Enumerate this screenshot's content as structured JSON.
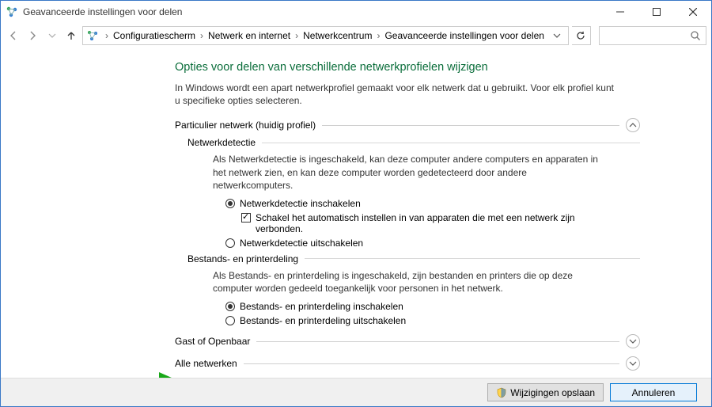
{
  "window": {
    "title": "Geavanceerde instellingen voor delen"
  },
  "breadcrumb": {
    "seg1": "Configuratiescherm",
    "seg2": "Netwerk en internet",
    "seg3": "Netwerkcentrum",
    "seg4": "Geavanceerde instellingen voor delen"
  },
  "page": {
    "heading": "Opties voor delen van verschillende netwerkprofielen wijzigen",
    "sub": "In Windows wordt een apart netwerkprofiel gemaakt voor elk netwerk dat u gebruikt. Voor elk profiel kunt u specifieke opties selecteren."
  },
  "sections": {
    "private_label": "Particulier netwerk (huidig profiel)",
    "guest_label": "Gast of Openbaar",
    "all_label": "Alle netwerken"
  },
  "network_discovery": {
    "title": "Netwerkdetectie",
    "desc": "Als Netwerkdetectie is ingeschakeld, kan deze computer andere computers en apparaten in het netwerk zien, en kan deze computer worden gedetecteerd door andere netwerkcomputers.",
    "on": "Netwerkdetectie inschakelen",
    "auto": "Schakel het automatisch instellen in van apparaten die met een netwerk zijn verbonden.",
    "off": "Netwerkdetectie uitschakelen"
  },
  "file_sharing": {
    "title": "Bestands- en printerdeling",
    "desc": "Als Bestands- en printerdeling is ingeschakeld, zijn bestanden en printers die op deze computer worden gedeeld toegankelijk voor personen in het netwerk.",
    "on": "Bestands- en printerdeling inschakelen",
    "off": "Bestands- en printerdeling uitschakelen"
  },
  "footer": {
    "save": "Wijzigingen opslaan",
    "cancel": "Annuleren"
  }
}
